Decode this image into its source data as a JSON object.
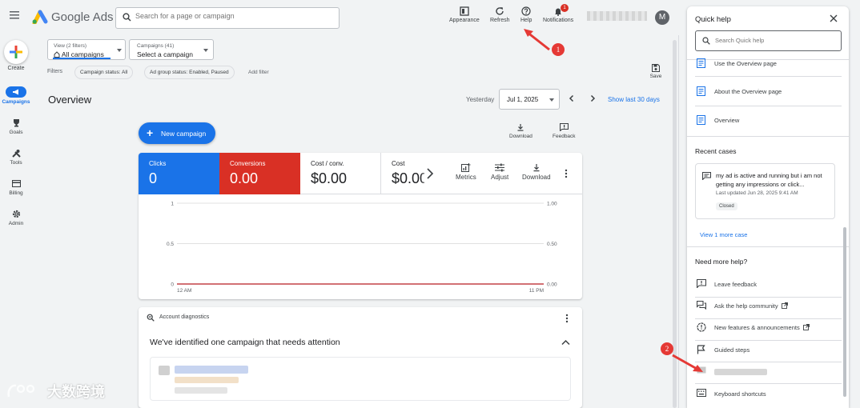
{
  "app": {
    "brand": "Google Ads"
  },
  "search": {
    "placeholder": "Search for a page or campaign"
  },
  "toolbar": [
    {
      "label": "Appearance",
      "icon": "appearance-icon"
    },
    {
      "label": "Refresh",
      "icon": "refresh-icon"
    },
    {
      "label": "Help",
      "icon": "help-icon"
    },
    {
      "label": "Notifications",
      "icon": "bell-icon",
      "badge": "1"
    }
  ],
  "account": {
    "avatar_letter": "M"
  },
  "nav": {
    "create": "Create",
    "items": [
      {
        "label": "Campaigns",
        "icon": "megaphone-icon",
        "active": true
      },
      {
        "label": "Goals",
        "icon": "trophy-icon"
      },
      {
        "label": "Tools",
        "icon": "tools-icon"
      },
      {
        "label": "Billing",
        "icon": "credit-card-icon"
      },
      {
        "label": "Admin",
        "icon": "gear-icon"
      }
    ]
  },
  "filters": {
    "view_label": "View (2 filters)",
    "view_value": "All campaigns",
    "campaigns_label": "Campaigns (41)",
    "campaigns_value": "Select a campaign",
    "filters_label": "Filters",
    "chips": [
      "Campaign status: All",
      "Ad group status: Enabled, Paused"
    ],
    "add_filter": "Add filter",
    "save": "Save"
  },
  "overview": {
    "title": "Overview",
    "date_prefix": "Yesterday",
    "date": "Jul 1, 2025",
    "show_last": "Show last 30 days",
    "new_campaign": "New campaign",
    "download": "Download",
    "feedback": "Feedback"
  },
  "metrics": {
    "tiles": [
      {
        "label": "Clicks",
        "value": "0",
        "color": "#1a73e8"
      },
      {
        "label": "Conversions",
        "value": "0.00",
        "color": "#d93025"
      },
      {
        "label": "Cost / conv.",
        "value": "$0.00"
      },
      {
        "label": "Cost",
        "value": "$0.00"
      }
    ],
    "actions": [
      "Metrics",
      "Adjust",
      "Download"
    ]
  },
  "chart_data": {
    "type": "line",
    "x_tick_labels": [
      "12 AM",
      "11 PM"
    ],
    "y_left_ticks": [
      "1",
      "0.5",
      "0"
    ],
    "y_right_ticks": [
      "1.00",
      "0.50",
      "0.00"
    ],
    "series": [
      {
        "values": [
          0,
          0
        ],
        "color": "#d93025"
      },
      {
        "values": [
          0,
          0
        ],
        "color": "#1a73e8"
      }
    ],
    "ylim": [
      0,
      1
    ],
    "grid": true
  },
  "diagnostics": {
    "header": "Account diagnostics",
    "message": "We've identified one campaign that needs attention"
  },
  "quick_help": {
    "title": "Quick help",
    "search_placeholder": "Search Quick help",
    "articles": [
      "Use the Overview page",
      "About the Overview page",
      "Overview"
    ],
    "recent_cases_title": "Recent cases",
    "case": {
      "question": "my ad is active and running but i am not getting any impressions or click...",
      "updated": "Last updated Jun 28, 2025 9:41 AM",
      "status": "Closed"
    },
    "view_more": "View 1 more case",
    "need_more_title": "Need more help?",
    "links": [
      {
        "label": "Leave feedback",
        "icon": "feedback-icon"
      },
      {
        "label": "Ask the help community",
        "icon": "forum-icon",
        "external": true
      },
      {
        "label": "New features & announcements",
        "icon": "new-features-icon",
        "external": true
      },
      {
        "label": "Guided steps",
        "icon": "flag-icon"
      },
      {
        "label": "",
        "icon": "chat-icon"
      },
      {
        "label": "Keyboard shortcuts",
        "icon": "keyboard-icon"
      }
    ]
  },
  "annotations": {
    "marker1": "1",
    "marker2": "2"
  },
  "watermark": "大数跨境"
}
